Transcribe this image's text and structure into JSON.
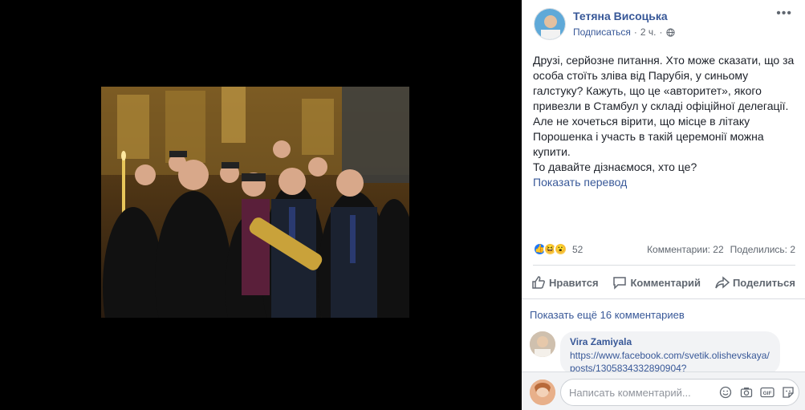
{
  "post": {
    "author": "Тетяна Висоцька",
    "follow": "Подписаться",
    "time": "2 ч.",
    "separator": "·",
    "text": "Друзі, серйозне питання. Хто може сказати, що за особа стоїть зліва від Парубія, у синьому галстуку? Кажуть, що це «авторитет», якого привезли в Стамбул у складі офіційної делегації. Але не хочеться вірити, що місце в літаку Порошенка і участь в такій церемонії можна купити.",
    "text2": "То давайте дізнаємося, хто це?",
    "translate": "Показать перевод",
    "more_icon": "ellipsis-icon"
  },
  "stats": {
    "reaction_count": "52",
    "comments": "Комментарии: 22",
    "shares": "Поделились: 2",
    "reaction_icons": [
      "like-icon",
      "haha-icon",
      "wow-icon"
    ]
  },
  "actions": {
    "like": "Нравится",
    "comment": "Комментарий",
    "share": "Поделиться"
  },
  "comments": {
    "show_more": "Показать ещё 16 комментариев",
    "items": [
      {
        "author": "Vira Zamiyala",
        "text": "https://www.facebook.com/svetik.olishevskaya/posts/1305834332890904?"
      }
    ]
  },
  "composer": {
    "placeholder": "Написать комментарий...",
    "icons": [
      "emoji-icon",
      "camera-icon",
      "gif-icon",
      "sticker-icon"
    ],
    "gif_label": "GIF"
  },
  "colors": {
    "link": "#385898",
    "text": "#1d2129",
    "meta": "#606770",
    "like_blue": "#2078f4"
  }
}
